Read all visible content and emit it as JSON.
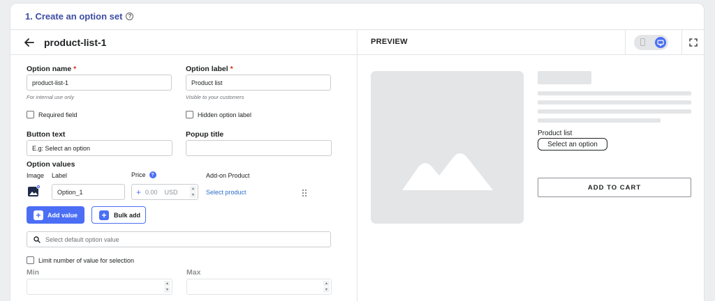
{
  "step": {
    "title": "1. Create an option set",
    "help_icon": "?"
  },
  "option_set": {
    "name": "product-list-1"
  },
  "form": {
    "option_name": {
      "label": "Option name",
      "required_mark": "*",
      "value": "product-list-1",
      "hint": "For internal use only"
    },
    "option_label": {
      "label": "Option label",
      "required_mark": "*",
      "value": "Product list",
      "hint": "Visible to your customers"
    },
    "required_field": {
      "label": "Required field",
      "checked": false
    },
    "hidden_option_label": {
      "label": "Hidden option label",
      "checked": false
    },
    "button_text": {
      "label": "Button text",
      "placeholder": "E.g: Select an option"
    },
    "popup_title": {
      "label": "Popup title",
      "value": ""
    },
    "option_values": {
      "heading": "Option values",
      "columns": {
        "image": "Image",
        "label": "Label",
        "price": "Price",
        "addon": "Add-on Product"
      },
      "price_info": "?",
      "rows": [
        {
          "label": "Option_1",
          "price_prefix": "+",
          "price_placeholder": "0.00",
          "currency": "USD",
          "addon_link": "Select product"
        }
      ]
    },
    "add_value_button": {
      "icon": "+",
      "label": "Add value"
    },
    "bulk_add_button": {
      "icon": "+",
      "label": "Bulk add"
    },
    "default_option": {
      "placeholder": "Select default option value"
    },
    "limit_selection": {
      "label": "Limit number of value for selection",
      "checked": false
    },
    "min": {
      "label": "Min",
      "value": ""
    },
    "max": {
      "label": "Max",
      "value": ""
    }
  },
  "preview": {
    "title": "PREVIEW",
    "device_selected": "desktop",
    "product_label": "Product list",
    "select_button": "Select an option",
    "add_to_cart": "ADD TO CART"
  },
  "colors": {
    "accent": "#4b6ef5",
    "step_title": "#3d4ca4",
    "required": "#d72c0d",
    "link": "#2c6ecb"
  }
}
